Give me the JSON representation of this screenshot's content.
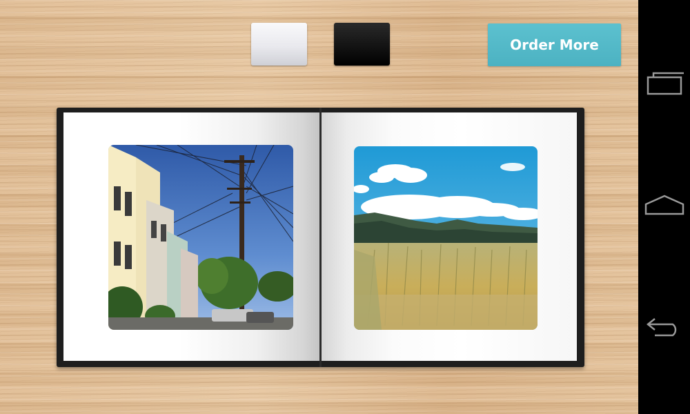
{
  "toolbar": {
    "cover_options": [
      {
        "name": "white",
        "color": "#eeeef2"
      },
      {
        "name": "black",
        "color": "#111111"
      }
    ],
    "order_button_label": "Order More",
    "accent_color": "#53b8c8"
  },
  "book": {
    "pages": [
      {
        "side": "left",
        "photo": "street-with-houses-and-power-pole"
      },
      {
        "side": "right",
        "photo": "tall-grass-field-with-hills-and-clouds"
      }
    ]
  },
  "navbar": {
    "buttons": [
      {
        "name": "recents",
        "icon": "recent-apps-icon"
      },
      {
        "name": "home",
        "icon": "home-icon"
      },
      {
        "name": "back",
        "icon": "back-icon"
      }
    ]
  }
}
